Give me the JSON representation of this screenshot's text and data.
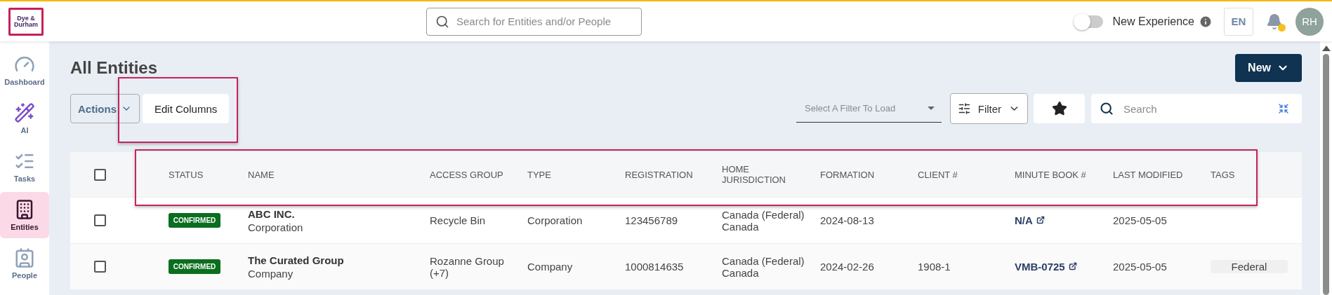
{
  "logo": {
    "lines": [
      "Dye &",
      "Durham"
    ]
  },
  "top_bar": {
    "search": {
      "placeholder": "Search for Entities and/or People"
    },
    "new_experience": {
      "label": "New Experience",
      "on": false
    },
    "language": "EN",
    "notifications": {
      "unread": true
    },
    "avatar": "RH"
  },
  "sidebar": {
    "items": [
      {
        "label": "Dashboard",
        "kind": "dashboard",
        "selected": false
      },
      {
        "label": "AI",
        "kind": "ai",
        "selected": false
      },
      {
        "label": "Tasks",
        "kind": "tasks",
        "selected": false
      },
      {
        "label": "Entities",
        "kind": "entities",
        "selected": true
      },
      {
        "label": "People",
        "kind": "people",
        "selected": false
      }
    ]
  },
  "page": {
    "title": "All Entities",
    "new_button": "New",
    "actions_button": "Actions",
    "edit_columns": {
      "label": "Edit Columns",
      "highlighted": true
    },
    "filter_select": {
      "placeholder": "Select A Filter To Load"
    },
    "filter_button": "Filter",
    "search": {
      "placeholder": "Search"
    }
  },
  "table": {
    "header_highlighted": true,
    "header_checked": false,
    "columns": [
      "STATUS",
      "NAME",
      "ACCESS GROUP",
      "TYPE",
      "REGISTRATION",
      "HOME JURISDICTION",
      "FORMATION",
      "CLIENT #",
      "MINUTE BOOK #",
      "LAST MODIFIED",
      "TAGS"
    ],
    "rows": [
      {
        "checked": false,
        "status": "CONFIRMED",
        "name": "ABC INC.",
        "subtype": "Corporation",
        "access_group": "Recycle Bin",
        "type": "Corporation",
        "registration": "123456789",
        "home_jurisdiction": [
          "Canada (Federal)",
          "Canada"
        ],
        "formation": "2024-08-13",
        "minute_book": "N/A",
        "last_modified": "2025-05-05"
      },
      {
        "checked": false,
        "status": "CONFIRMED",
        "name": "The Curated Group",
        "subtype": "Company",
        "access_group": "Rozanne Group (+7)",
        "type": "Company",
        "registration": "1000814635",
        "home_jurisdiction": [
          "Canada (Federal)",
          "Canada"
        ],
        "formation": "2024-02-26",
        "client": "1908-1",
        "minute_book": "VMB-0725",
        "last_modified": "2025-05-05",
        "tags": [
          "Federal"
        ]
      }
    ]
  }
}
